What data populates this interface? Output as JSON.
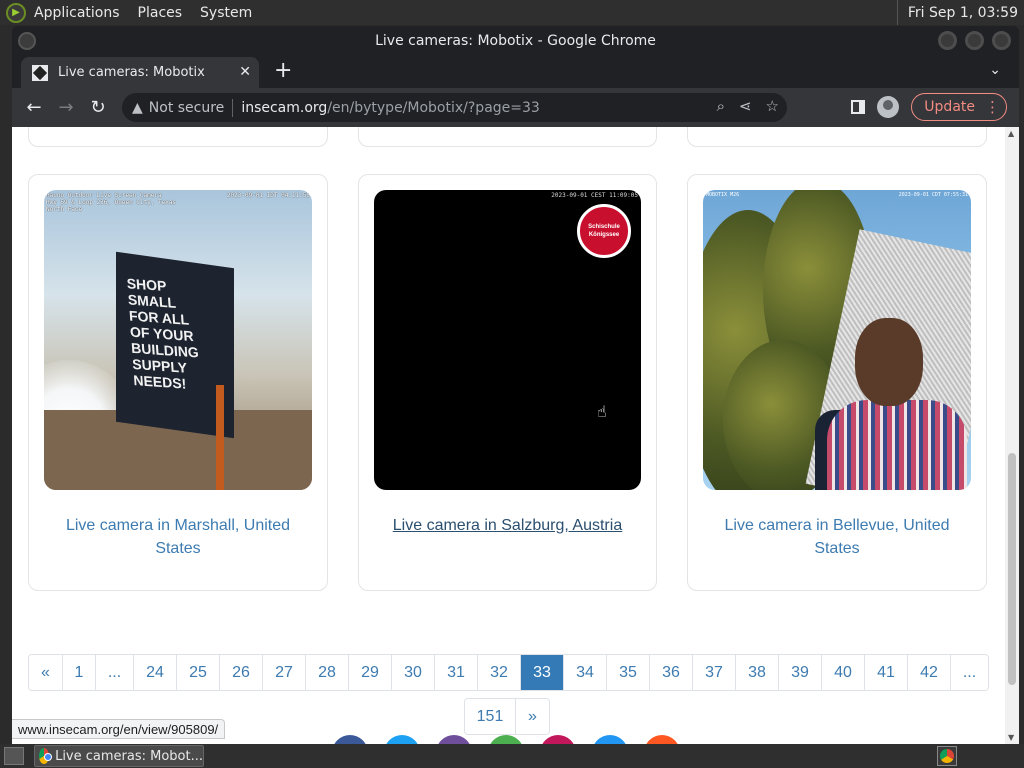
{
  "desktop": {
    "menus": [
      "Applications",
      "Places",
      "System"
    ],
    "clock": "Fri Sep 1, 03:59"
  },
  "window": {
    "title": "Live cameras: Mobotix - Google Chrome"
  },
  "tab": {
    "title": "Live cameras: Mobotix",
    "close": "✕",
    "new_tab": "+"
  },
  "toolbar": {
    "not_secure": "Not secure",
    "url_host": "insecam.org",
    "url_path": "/en/bytype/Mobotix/?page=33",
    "update_label": "Update"
  },
  "cameras": [
    {
      "caption": "Live camera in Marshall, United States",
      "overlay_left": "Hauno Outdoor Live Screen Camera\nHwy 59 & Loop 236, Queen City, Texas\nNorth Face",
      "overlay_right": "2023-09-01 IDT 04:11:55",
      "billboard_text": "SHOP\nSMALL\nFOR ALL\nOF YOUR\nBUILDING\nSUPPLY\nNEEDS!"
    },
    {
      "caption": "Live camera in Salzburg, Austria",
      "overlay_right": "2023-09-01 CEST 11:09:05",
      "brand": "Schischule\nKönigssee"
    },
    {
      "caption": "Live camera in Bellevue, United States",
      "overlay_left": "MOBOTIX M26",
      "overlay_right": "2023-09-01 CDT 07:55:31"
    }
  ],
  "pagination": {
    "row1": [
      "«",
      "1",
      "...",
      "24",
      "25",
      "26",
      "27",
      "28",
      "29",
      "30",
      "31",
      "32",
      "33",
      "34",
      "35",
      "36",
      "37",
      "38",
      "39",
      "40",
      "41",
      "42",
      "..."
    ],
    "active": "33",
    "row2": [
      "151",
      "»"
    ]
  },
  "status_bar": {
    "link": "www.insecam.org/en/view/905809/"
  },
  "taskbar": {
    "task_label": "Live cameras: Mobot..."
  },
  "colors": {
    "link": "#3d7bb0",
    "active_page": "#337ab7",
    "update_accent": "#f28b82"
  }
}
